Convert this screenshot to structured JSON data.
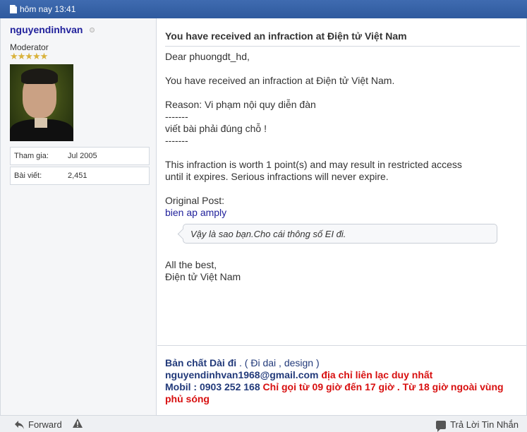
{
  "header": {
    "timestamp": "hôm nay 13:41"
  },
  "user": {
    "name": "nguyendinhvan",
    "title": "Moderator",
    "stars": "★★★★★",
    "stats": [
      {
        "label": "Tham gia:",
        "value": "Jul 2005"
      },
      {
        "label": "Bài viết:",
        "value": "2,451"
      }
    ]
  },
  "message": {
    "title": "You have received an infraction at Điện tử Việt Nam",
    "greeting": "Dear phuongdt_hd,",
    "line1": "You have received an infraction at Điện tử Việt Nam.",
    "reason": "Reason: Vi phạm nội quy diễn đàn",
    "sep1": "-------",
    "detail": "viết bài phải đúng chỗ !",
    "sep2": "-------",
    "worth1": "This infraction is worth 1 point(s) and may result in restricted access",
    "worth2": "until it expires. Serious infractions will never expire.",
    "original_label": "Original Post:",
    "original_link": "bien ap amply",
    "quote": "Vậy là sao bạn.Cho cái thông số EI đi.",
    "closing1": "All the best,",
    "closing2": "Điện tử Việt Nam"
  },
  "signature": {
    "line1_bold": "Bản chất Dài đi",
    "line1_rest": ". ( Đi dai , design )",
    "email": "nguyendinhvan1968@gmail.com",
    "email_note": "địa chỉ liên lạc duy nhất",
    "mobile": "Mobil : 0903 252 168",
    "mobile_note": "Chỉ gọi từ 09 giờ đến 17 giờ . Từ 18 giờ ngoài vùng",
    "mobile_note2": "phủ sóng"
  },
  "footer": {
    "forward_label": "Forward",
    "reply_label": "Trả Lời Tin Nhắn"
  },
  "colors": {
    "header_bar": "#2f5a9e",
    "username": "#22229c",
    "signature_red": "#d81010"
  }
}
